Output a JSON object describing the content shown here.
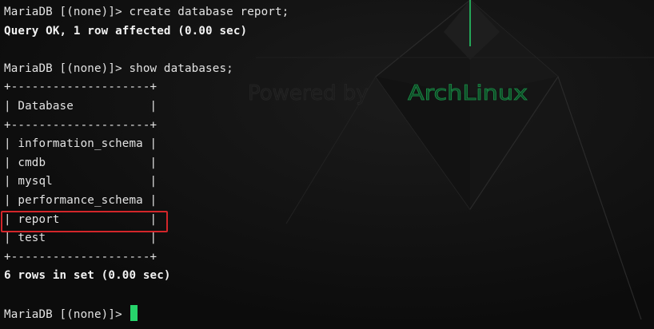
{
  "wallpaper": {
    "powered_by_text": "Powered by",
    "brand_text": "ArchLinux",
    "accent_color": "#27d46b"
  },
  "terminal": {
    "lines": [
      "MariaDB [(none)]> create database report;",
      "Query OK, 1 row affected (0.00 sec)",
      "",
      "MariaDB [(none)]> show databases;",
      "+--------------------+",
      "| Database           |",
      "+--------------------+",
      "| information_schema |",
      "| cmdb               |",
      "| mysql              |",
      "| performance_schema |",
      "| report             |",
      "| test               |",
      "+--------------------+",
      "6 rows in set (0.00 sec)",
      "",
      "MariaDB [(none)]> "
    ],
    "highlight_color": "#d3262a",
    "cursor_color": "#27d46b"
  }
}
